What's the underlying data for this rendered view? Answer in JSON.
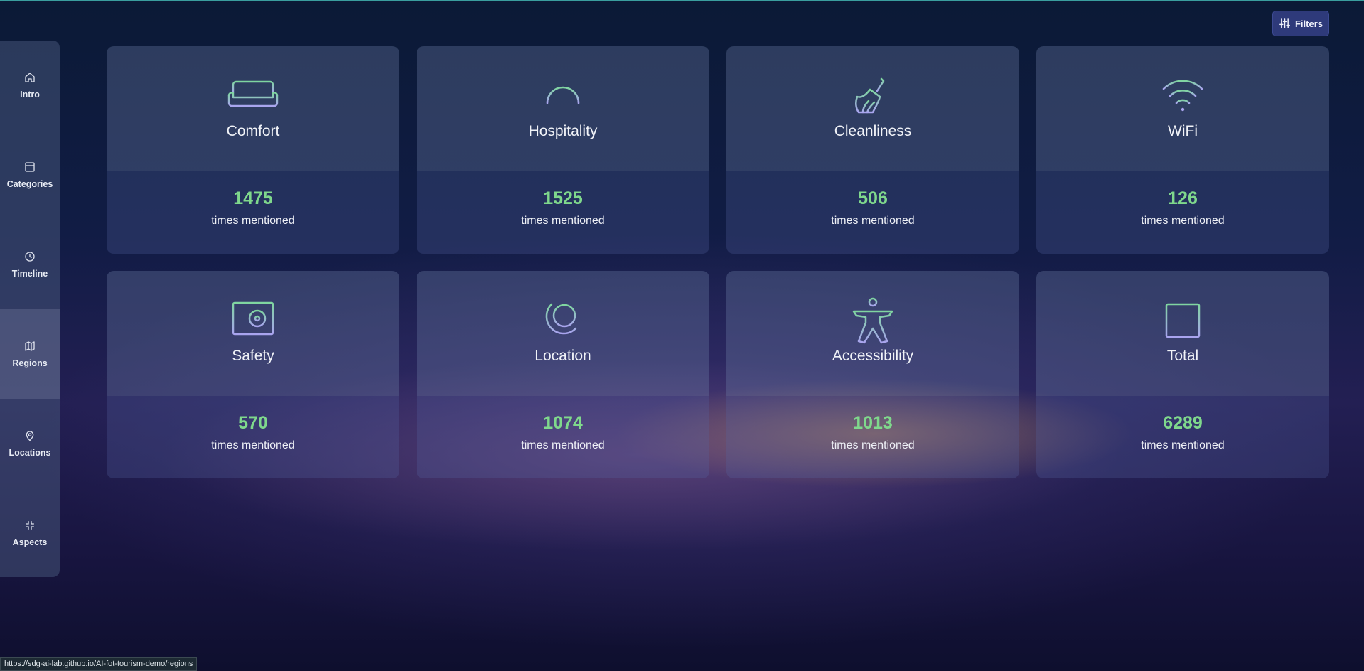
{
  "browser": {
    "status_url": "https://sdg-ai-lab.github.io/AI-fot-tourism-demo/regions"
  },
  "header": {
    "filters_label": "Filters",
    "filters_icon": "sliders-icon"
  },
  "sidebar": {
    "items": [
      {
        "label": "Intro",
        "icon": "home-icon"
      },
      {
        "label": "Categories",
        "icon": "layout-icon"
      },
      {
        "label": "Timeline",
        "icon": "clock-icon"
      },
      {
        "label": "Regions",
        "icon": "map-icon",
        "active": true
      },
      {
        "label": "Locations",
        "icon": "map-pin-icon"
      },
      {
        "label": "Aspects",
        "icon": "minimize-icon"
      }
    ]
  },
  "cards": [
    {
      "title": "Comfort",
      "count": "1475",
      "caption": "times mentioned",
      "icon": "sofa-icon"
    },
    {
      "title": "Hospitality",
      "count": "1525",
      "caption": "times mentioned",
      "icon": "service-bell-icon"
    },
    {
      "title": "Cleanliness",
      "count": "506",
      "caption": "times mentioned",
      "icon": "broom-icon"
    },
    {
      "title": "WiFi",
      "count": "126",
      "caption": "times mentioned",
      "icon": "wifi-icon"
    },
    {
      "title": "Safety",
      "count": "570",
      "caption": "times mentioned",
      "icon": "safe-icon"
    },
    {
      "title": "Location",
      "count": "1074",
      "caption": "times mentioned",
      "icon": "globe-icon"
    },
    {
      "title": "Accessibility",
      "count": "1013",
      "caption": "times mentioned",
      "icon": "accessibility-icon"
    },
    {
      "title": "Total",
      "count": "6289",
      "caption": "times mentioned",
      "icon": "plus-square-icon"
    }
  ],
  "colors": {
    "accent_green": "#7fd88c",
    "icon_stroke_green": "#7fd6a0",
    "icon_stroke_purple": "#a9a4ef",
    "filters_button": "#2e3a7a"
  }
}
